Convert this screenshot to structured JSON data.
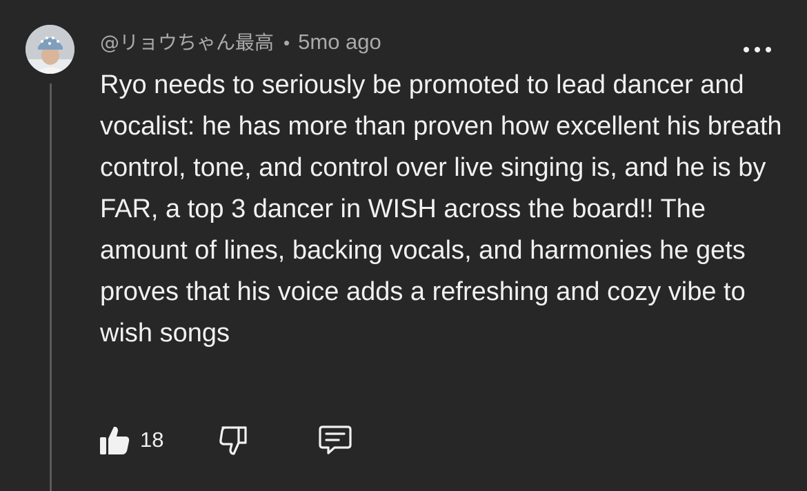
{
  "comment": {
    "author_handle": "@リョウちゃん最高",
    "separator": "•",
    "timestamp": "5mo ago",
    "text": "Ryo needs to seriously be promoted to lead dancer and vocalist: he has more than proven how excellent his breath control, tone, and control over live singing is, and he is by FAR, a top 3 dancer in WISH across the board!! The amount of lines, backing vocals, and harmonies he gets proves that his voice adds a refreshing and cozy vibe to wish songs",
    "like_count": "18"
  },
  "icons": {
    "more": "more-horizontal-icon",
    "like": "thumbs-up-filled-icon",
    "dislike": "thumbs-down-outline-icon",
    "reply": "comment-reply-icon"
  },
  "colors": {
    "background": "#272727",
    "text_primary": "#f1f1f1",
    "text_secondary": "#aaaaaa",
    "thread_line": "#5a5a5a"
  }
}
